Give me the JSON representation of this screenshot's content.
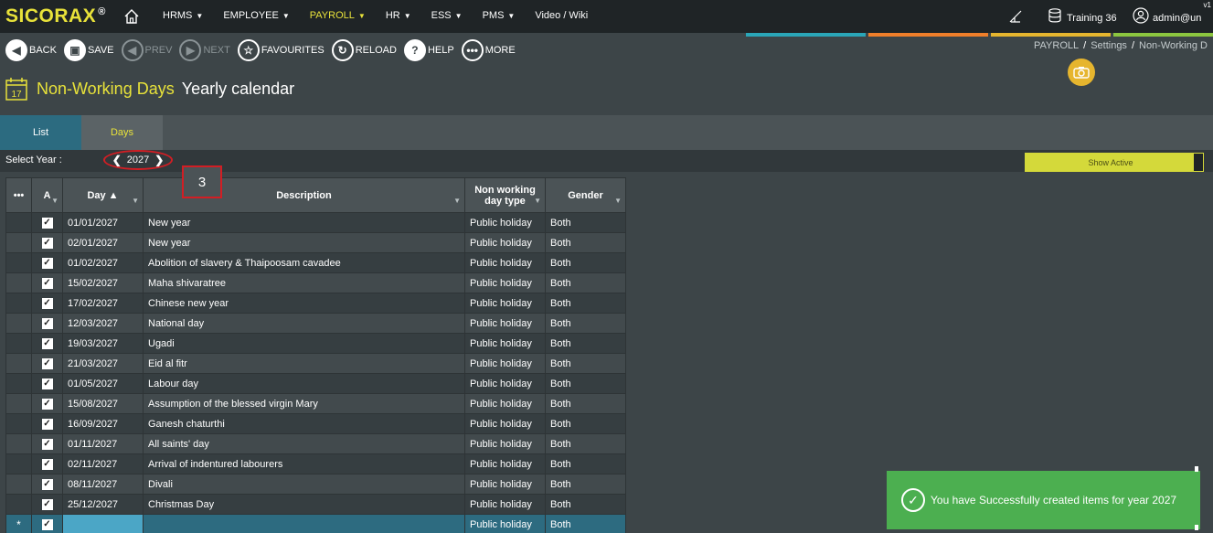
{
  "app": {
    "logo": "SICORAX",
    "reg": "®",
    "version": "v1"
  },
  "nav": {
    "items": [
      {
        "label": "HRMS",
        "caret": true
      },
      {
        "label": "EMPLOYEE",
        "caret": true
      },
      {
        "label": "PAYROLL",
        "caret": true,
        "active": true
      },
      {
        "label": "HR",
        "caret": true
      },
      {
        "label": "ESS",
        "caret": true
      },
      {
        "label": "PMS",
        "caret": true
      },
      {
        "label": "Video / Wiki",
        "caret": false
      }
    ],
    "training": "Training 36",
    "user": "admin@un"
  },
  "strip_colors": [
    "#2aa6b8",
    "#f07f2a",
    "#e6b52e",
    "#8cc63f"
  ],
  "toolbar": {
    "back": "BACK",
    "save": "SAVE",
    "prev": "PREV",
    "next": "NEXT",
    "favourites": "FAVOURITES",
    "reload": "RELOAD",
    "help": "HELP",
    "more": "MORE"
  },
  "breadcrumb": [
    "PAYROLL",
    "Settings",
    "Non-Working D"
  ],
  "title": {
    "main": "Non-Working Days",
    "sub": "Yearly calendar",
    "icon_day": "17"
  },
  "tabs": {
    "list": "List",
    "days": "Days"
  },
  "filter": {
    "label": "Select Year :",
    "year": "2027",
    "show_active": "Show Active"
  },
  "marker": "3",
  "grid": {
    "headers": {
      "menu": "•••",
      "active": "A",
      "day": "Day ▲",
      "description": "Description",
      "type_line1": "Non working",
      "type_line2": "day type",
      "gender": "Gender"
    },
    "rows": [
      {
        "day": "01/01/2027",
        "desc": "New year",
        "type": "Public holiday",
        "gender": "Both"
      },
      {
        "day": "02/01/2027",
        "desc": "New year",
        "type": "Public holiday",
        "gender": "Both"
      },
      {
        "day": "01/02/2027",
        "desc": "Abolition of slavery & Thaipoosam cavadee",
        "type": "Public holiday",
        "gender": "Both"
      },
      {
        "day": "15/02/2027",
        "desc": "Maha shivaratree",
        "type": "Public holiday",
        "gender": "Both"
      },
      {
        "day": "17/02/2027",
        "desc": "Chinese new year",
        "type": "Public holiday",
        "gender": "Both"
      },
      {
        "day": "12/03/2027",
        "desc": "National day",
        "type": "Public holiday",
        "gender": "Both"
      },
      {
        "day": "19/03/2027",
        "desc": "Ugadi",
        "type": "Public holiday",
        "gender": "Both"
      },
      {
        "day": "21/03/2027",
        "desc": "Eid al fitr",
        "type": "Public holiday",
        "gender": "Both"
      },
      {
        "day": "01/05/2027",
        "desc": "Labour day",
        "type": "Public holiday",
        "gender": "Both"
      },
      {
        "day": "15/08/2027",
        "desc": "Assumption of the blessed virgin Mary",
        "type": "Public holiday",
        "gender": "Both"
      },
      {
        "day": "16/09/2027",
        "desc": "Ganesh chaturthi",
        "type": "Public holiday",
        "gender": "Both"
      },
      {
        "day": "01/11/2027",
        "desc": "All saints' day",
        "type": "Public holiday",
        "gender": "Both"
      },
      {
        "day": "02/11/2027",
        "desc": "Arrival of indentured labourers",
        "type": "Public holiday",
        "gender": "Both"
      },
      {
        "day": "08/11/2027",
        "desc": "Divali",
        "type": "Public holiday",
        "gender": "Both"
      },
      {
        "day": "25/12/2027",
        "desc": "Christmas Day",
        "type": "Public holiday",
        "gender": "Both"
      }
    ],
    "new_row": {
      "marker": "*",
      "type": "Public holiday",
      "gender": "Both"
    }
  },
  "toast": {
    "message": "You have Successfully created items for year 2027"
  }
}
